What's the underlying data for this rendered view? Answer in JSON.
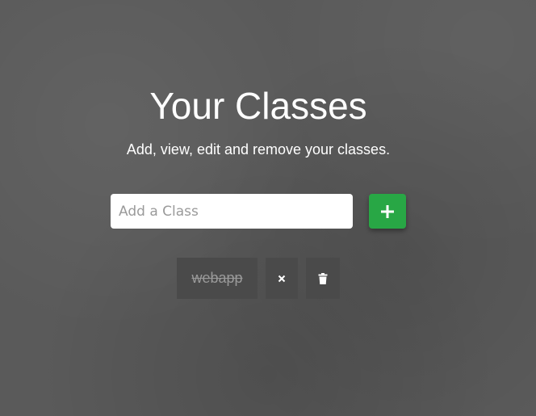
{
  "header": {
    "title": "Your Classes",
    "subtitle": "Add, view, edit and remove your classes."
  },
  "add_form": {
    "input_placeholder": "Add a Class",
    "input_value": "",
    "add_button_icon": "plus-icon",
    "accent_color": "#28a745"
  },
  "classes": [
    {
      "name": "webapp",
      "completed": true,
      "actions": [
        {
          "icon": "close-icon"
        },
        {
          "icon": "trash-icon"
        }
      ]
    }
  ]
}
